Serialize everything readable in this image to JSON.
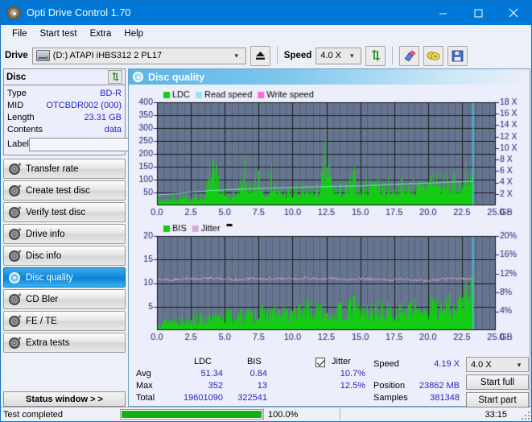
{
  "window": {
    "title": "Opti Drive Control 1.70",
    "app_icon": "disc-icon",
    "minimize": "minimize-icon",
    "maximize": "maximize-icon",
    "close": "close-icon"
  },
  "menu": {
    "items": [
      {
        "label": "File"
      },
      {
        "label": "Start test"
      },
      {
        "label": "Extra"
      },
      {
        "label": "Help"
      }
    ]
  },
  "toolbar": {
    "drive_label": "Drive",
    "drive_value": "(D:)  ATAPI iHBS312  2 PL17",
    "eject_icon": "eject-icon",
    "speed_label": "Speed",
    "speed_value": "4.0 X",
    "refresh_icon": "refresh-icon",
    "eraser_icon": "eraser-icon",
    "bitsetting_icon": "bitsetting-icon",
    "save_icon": "save-icon"
  },
  "sidebar": {
    "disc": {
      "title": "Disc",
      "refresh_icon": "refresh-icon",
      "rows": [
        {
          "key": "Type",
          "value": "BD-R"
        },
        {
          "key": "MID",
          "value": "OTCBDR002 (000)"
        },
        {
          "key": "Length",
          "value": "23.31 GB"
        },
        {
          "key": "Contents",
          "value": "data"
        }
      ],
      "label_key": "Label",
      "label_value": "",
      "label_placeholder": "",
      "label_button_icon": "disc-icon"
    },
    "nav_items": [
      {
        "label": "Transfer rate",
        "icon": "disc-test-icon",
        "active": false
      },
      {
        "label": "Create test disc",
        "icon": "disc-test-icon",
        "active": false
      },
      {
        "label": "Verify test disc",
        "icon": "disc-test-icon",
        "active": false
      },
      {
        "label": "Drive info",
        "icon": "disc-test-icon",
        "active": false
      },
      {
        "label": "Disc info",
        "icon": "disc-test-icon",
        "active": false
      },
      {
        "label": "Disc quality",
        "icon": "disc-test-icon",
        "active": true
      },
      {
        "label": "CD Bler",
        "icon": "disc-test-icon",
        "active": false
      },
      {
        "label": "FE / TE",
        "icon": "disc-test-icon",
        "active": false
      },
      {
        "label": "Extra tests",
        "icon": "disc-test-icon",
        "active": false
      }
    ],
    "status_window_button": "Status window > >"
  },
  "panel": {
    "title": "Disc quality",
    "icon": "disc-test-icon"
  },
  "stats": {
    "col_ldc": "LDC",
    "col_bis": "BIS",
    "row_avg": "Avg",
    "row_max": "Max",
    "row_total": "Total",
    "ldc_avg": "51.34",
    "ldc_max": "352",
    "ldc_total": "19601090",
    "bis_avg": "0.84",
    "bis_max": "13",
    "bis_total": "322541",
    "jitter_label": "Jitter",
    "jitter_checked": true,
    "jitter_avg": "10.7%",
    "jitter_max": "12.5%",
    "speed_label": "Speed",
    "speed_value": "4.19 X",
    "position_label": "Position",
    "position_value": "23862 MB",
    "samples_label": "Samples",
    "samples_value": "381348",
    "speed_select": "4.0 X",
    "start_full": "Start full",
    "start_part": "Start part"
  },
  "statusbar": {
    "message": "Test completed",
    "progress_percent": 100,
    "progress_text": "100.0%",
    "elapsed": "33:15"
  },
  "colors": {
    "accent": "#0078d7",
    "plot_bg": "#667590",
    "ldc_green": "#14cc14",
    "read_speed": "#9fe3f5",
    "write_speed": "#ff66e0",
    "jitter_pink": "#d9a8d9",
    "cursor_cyan": "#3fd0f0",
    "value_blue": "#2626c8"
  },
  "chart_data": [
    {
      "type": "area",
      "id": "disc-quality-ldc",
      "title": "",
      "xlabel": "GB",
      "ylabel": "",
      "xlim": [
        0,
        25
      ],
      "xticks": [
        "0.0",
        "2.5",
        "5.0",
        "7.5",
        "10.0",
        "12.5",
        "15.0",
        "17.5",
        "20.0",
        "22.5",
        "25.0"
      ],
      "ylim": [
        0,
        400
      ],
      "yticks": [
        "50",
        "100",
        "150",
        "200",
        "250",
        "300",
        "350",
        "400"
      ],
      "y2lim": [
        0,
        18
      ],
      "y2ticks": [
        "2 X",
        "4 X",
        "6 X",
        "8 X",
        "10 X",
        "12 X",
        "14 X",
        "16 X",
        "18 X"
      ],
      "grid": true,
      "legend": [
        "LDC",
        "Read speed",
        "Write speed"
      ],
      "legend_position": "top-left",
      "data_end_gb": 23.3,
      "series": [
        {
          "name": "LDC",
          "color": "#14cc14",
          "kind": "spikes",
          "x": [
            0.0,
            0.5,
            1.0,
            1.5,
            2.0,
            2.5,
            3.0,
            3.5,
            4.0,
            4.2,
            4.5,
            5.0,
            5.5,
            6.0,
            6.5,
            6.8,
            7.0,
            7.5,
            8.0,
            8.5,
            9.0,
            9.5,
            10.0,
            10.5,
            11.0,
            11.5,
            12.0,
            12.5,
            13.0,
            13.5,
            14.0,
            14.5,
            15.0,
            15.5,
            16.0,
            16.5,
            17.0,
            17.5,
            18.0,
            18.5,
            19.0,
            19.5,
            20.0,
            20.5,
            21.0,
            21.5,
            22.0,
            22.5,
            23.0,
            23.3
          ],
          "values": [
            40,
            44,
            46,
            48,
            50,
            52,
            55,
            58,
            250,
            180,
            160,
            70,
            72,
            74,
            205,
            120,
            80,
            200,
            85,
            190,
            88,
            90,
            92,
            94,
            96,
            98,
            100,
            352,
            102,
            104,
            106,
            165,
            108,
            110,
            230,
            112,
            114,
            116,
            118,
            120,
            122,
            124,
            205,
            200,
            130,
            135,
            140,
            150,
            230,
            250
          ]
        },
        {
          "name": "Read speed",
          "color": "#9fe3f5",
          "kind": "line",
          "x": [
            0.0,
            1.0,
            2.0,
            3.0,
            4.0,
            5.0,
            6.0,
            7.0,
            8.0,
            9.0,
            10.0,
            11.0,
            12.0,
            13.0,
            14.0,
            15.0,
            16.0,
            17.0,
            18.0,
            19.0,
            20.0,
            21.0,
            22.0,
            23.0,
            23.3
          ],
          "values": [
            1.8,
            2.0,
            2.2,
            2.4,
            2.6,
            2.7,
            2.8,
            2.9,
            3.0,
            3.05,
            3.1,
            3.2,
            3.25,
            3.3,
            3.35,
            3.4,
            3.5,
            3.6,
            3.7,
            3.8,
            3.9,
            4.0,
            4.1,
            4.19,
            4.19
          ],
          "axis": "right"
        },
        {
          "name": "Write speed",
          "color": "#ff66e0",
          "kind": "line",
          "x": [],
          "values": []
        }
      ],
      "cursor_gb": 23.3
    },
    {
      "type": "area",
      "id": "disc-quality-bis",
      "title": "",
      "xlabel": "GB",
      "ylabel": "",
      "xlim": [
        0,
        25
      ],
      "xticks": [
        "0.0",
        "2.5",
        "5.0",
        "7.5",
        "10.0",
        "12.5",
        "15.0",
        "17.5",
        "20.0",
        "22.5",
        "25.0"
      ],
      "ylim": [
        0,
        20
      ],
      "yticks": [
        "5",
        "10",
        "15",
        "20"
      ],
      "y2lim": [
        0,
        20
      ],
      "y2ticks": [
        "4%",
        "8%",
        "12%",
        "16%",
        "20%"
      ],
      "grid": true,
      "legend": [
        "BIS",
        "Jitter"
      ],
      "legend_position": "top-left",
      "data_end_gb": 23.3,
      "series": [
        {
          "name": "BIS",
          "color": "#14cc14",
          "kind": "spikes",
          "x": [
            0.0,
            0.5,
            1.0,
            1.5,
            2.0,
            2.5,
            3.0,
            3.5,
            4.0,
            4.5,
            5.0,
            5.5,
            6.0,
            6.5,
            7.0,
            7.5,
            8.0,
            8.5,
            9.0,
            9.5,
            10.0,
            10.5,
            11.0,
            11.5,
            12.0,
            12.5,
            13.0,
            13.5,
            14.0,
            14.5,
            15.0,
            15.5,
            16.0,
            16.5,
            17.0,
            17.5,
            18.0,
            18.5,
            19.0,
            19.5,
            20.0,
            20.5,
            21.0,
            21.5,
            22.0,
            22.5,
            23.0,
            23.3
          ],
          "values": [
            2.5,
            3.0,
            3.2,
            3.4,
            3.0,
            4.5,
            3.6,
            4.0,
            3.5,
            4.2,
            5.5,
            4.5,
            5.0,
            4.8,
            5.2,
            5.5,
            5.4,
            5.6,
            5.2,
            5.8,
            5.5,
            6.0,
            8.0,
            5.8,
            6.5,
            6.2,
            5.9,
            6.3,
            6.1,
            8.0,
            6.4,
            6.0,
            6.6,
            6.3,
            6.5,
            6.2,
            6.8,
            6.4,
            7.0,
            8.5,
            6.6,
            9.5,
            7.0,
            9.0,
            7.5,
            10.0,
            11.5,
            13.0
          ]
        },
        {
          "name": "Jitter",
          "color": "#d9a8d9",
          "kind": "line",
          "x": [
            0.0,
            1.0,
            2.0,
            3.0,
            4.0,
            5.0,
            6.0,
            7.0,
            8.0,
            9.0,
            10.0,
            11.0,
            12.0,
            13.0,
            14.0,
            15.0,
            16.0,
            17.0,
            18.0,
            19.0,
            20.0,
            21.0,
            22.0,
            23.0,
            23.3
          ],
          "values": [
            10.9,
            10.6,
            11.0,
            10.8,
            11.1,
            10.9,
            10.7,
            11.0,
            10.8,
            11.0,
            10.9,
            11.1,
            10.8,
            11.0,
            10.7,
            10.9,
            10.8,
            10.6,
            10.9,
            10.7,
            10.5,
            10.8,
            11.0,
            10.9,
            10.8
          ],
          "axis": "right"
        }
      ],
      "cursor_gb": 23.3
    }
  ]
}
